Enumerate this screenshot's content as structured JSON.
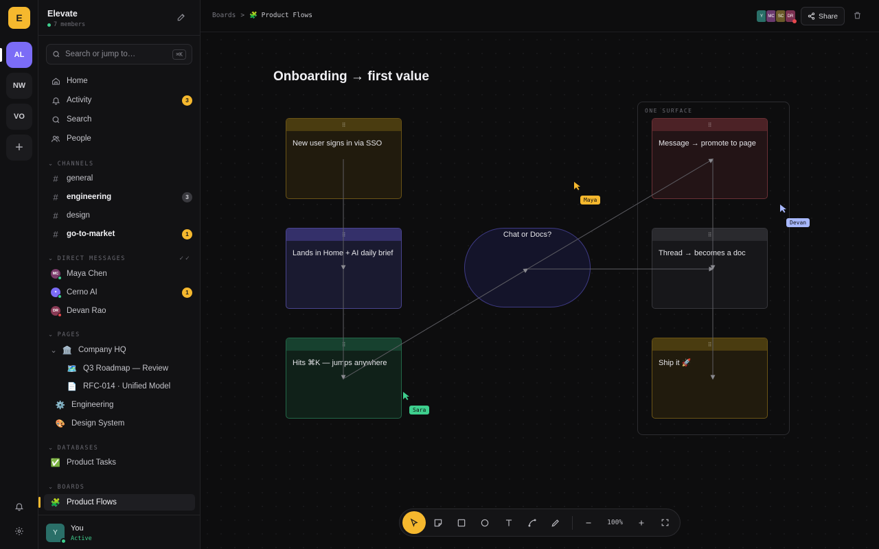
{
  "workspace": {
    "logo_letter": "E",
    "name": "Elevate",
    "members": "7 members",
    "rail": [
      {
        "initials": "AL",
        "active": true
      },
      {
        "initials": "NW",
        "active": false
      },
      {
        "initials": "VO",
        "active": false
      }
    ],
    "add_label": "+"
  },
  "search": {
    "placeholder": "Search or jump to…",
    "shortcut": "⌘K"
  },
  "nav": [
    {
      "label": "Home",
      "icon": "home-icon"
    },
    {
      "label": "Activity",
      "icon": "bell-icon",
      "badge": "3"
    },
    {
      "label": "Search",
      "icon": "search-icon"
    },
    {
      "label": "People",
      "icon": "people-icon"
    }
  ],
  "channels": {
    "header": "CHANNELS",
    "items": [
      {
        "name": "general"
      },
      {
        "name": "engineering",
        "badge": "3"
      },
      {
        "name": "design"
      },
      {
        "name": "go-to-market",
        "badge": "1"
      }
    ]
  },
  "dms": {
    "header": "DIRECT MESSAGES",
    "items": [
      {
        "name": "Maya Chen",
        "initials": "MC",
        "color": "#7a3c6b",
        "status": "#3ecf8e"
      },
      {
        "name": "Cerno AI",
        "initials": "✦",
        "color": "#7b6cf6",
        "status": "#3ecf8e",
        "badge": "1"
      },
      {
        "name": "Devan Rao",
        "initials": "DR",
        "color": "#8a3a55",
        "status": "#e5484d"
      }
    ]
  },
  "pages": {
    "header": "PAGES",
    "items": [
      {
        "name": "Company HQ",
        "emoji": "🏛️"
      },
      {
        "name": "Q3 Roadmap — Review",
        "emoji": "🗺️"
      },
      {
        "name": "RFC-014 · Unified Model",
        "emoji": "📄"
      },
      {
        "name": "Engineering",
        "emoji": "⚙️"
      },
      {
        "name": "Design System",
        "emoji": "🎨"
      }
    ]
  },
  "databases": {
    "header": "DATABASES",
    "items": [
      {
        "name": "Product Tasks",
        "emoji": "✅"
      }
    ]
  },
  "boards": {
    "header": "BOARDS",
    "items": [
      {
        "name": "Product Flows",
        "emoji": "🧩"
      }
    ]
  },
  "user": {
    "initial": "Y",
    "name": "You",
    "status": "Active"
  },
  "topbar": {
    "breadcrumb_root": "Boards",
    "breadcrumb_sep": ">",
    "breadcrumb_current": "🧩 Product Flows",
    "presence": [
      {
        "initials": "Y",
        "color": "#2a6f68"
      },
      {
        "initials": "MC",
        "color": "#6b3a6e"
      },
      {
        "initials": "SC",
        "color": "#6b5a2a"
      },
      {
        "initials": "DR",
        "color": "#7a3050"
      }
    ],
    "share_label": "Share"
  },
  "board": {
    "title": "Onboarding → first value",
    "frame_label": "ONE SURFACE",
    "handle": "⠿",
    "cards": [
      {
        "id": "c1",
        "text": "New user signs in via SSO",
        "color": "yellow"
      },
      {
        "id": "c2",
        "text": "Lands in Home + AI daily brief",
        "color": "purple"
      },
      {
        "id": "c3",
        "text": "Hits ⌘K — jumps anywhere",
        "color": "green"
      },
      {
        "id": "c4",
        "text": "Message → promote to page",
        "color": "red"
      },
      {
        "id": "c5",
        "text": "Thread → becomes a doc",
        "color": "grey"
      },
      {
        "id": "c6",
        "text": "Ship it 🚀",
        "color": "yellow"
      }
    ],
    "decision": "Chat or Docs?",
    "cursors": [
      {
        "name": "Maya",
        "color": "#f5b82e"
      },
      {
        "name": "Devan",
        "color": "#a8b8ff"
      },
      {
        "name": "Sara",
        "color": "#3ecf8e"
      }
    ]
  },
  "toolbar": {
    "zoom": "100%"
  }
}
